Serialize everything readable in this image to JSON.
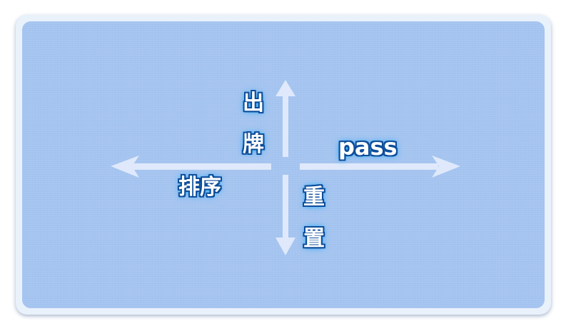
{
  "gesture_guide": {
    "up": {
      "char1": "出",
      "char2": "牌"
    },
    "right": {
      "label": "pass"
    },
    "left": {
      "label": "排序"
    },
    "down": {
      "char1": "重",
      "char2": "置"
    }
  },
  "colors": {
    "panel_background": "#a3c3ef",
    "arrow": "#dfe9fb",
    "label_text": "#ffffff",
    "label_outline": "#0d4d9a"
  }
}
